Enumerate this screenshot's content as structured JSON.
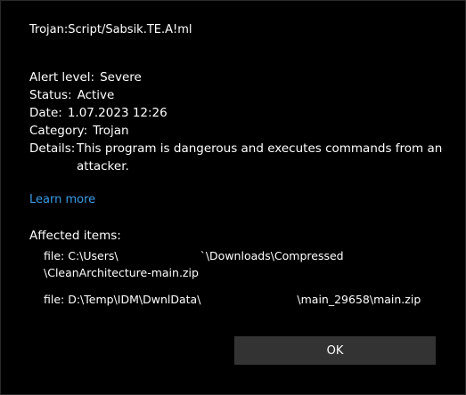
{
  "threat": {
    "name": "Trojan:Script/Sabsik.TE.A!ml"
  },
  "details": {
    "alert_level_label": "Alert level:",
    "alert_level_value": "Severe",
    "status_label": "Status:",
    "status_value": "Active",
    "date_label": "Date:",
    "date_value": "1.07.2023 12:26",
    "category_label": "Category:",
    "category_value": "Trojan",
    "details_label": "Details:",
    "details_value": "This program is dangerous and executes commands from an attacker."
  },
  "links": {
    "learn_more": "Learn more"
  },
  "affected": {
    "label": "Affected items:",
    "items": [
      {
        "prefix": "file: C:\\Users\\",
        "suffix": "`\\Downloads\\Compressed",
        "line2": "\\CleanArchitecture-main.zip"
      },
      {
        "prefix": "file: D:\\Temp\\IDM\\DwnlData\\",
        "suffix": "\\main_29658\\main.zip"
      }
    ]
  },
  "buttons": {
    "ok": "OK"
  },
  "colors": {
    "background": "#000000",
    "text": "#ffffff",
    "link": "#3b9ce9",
    "button": "#333333"
  }
}
